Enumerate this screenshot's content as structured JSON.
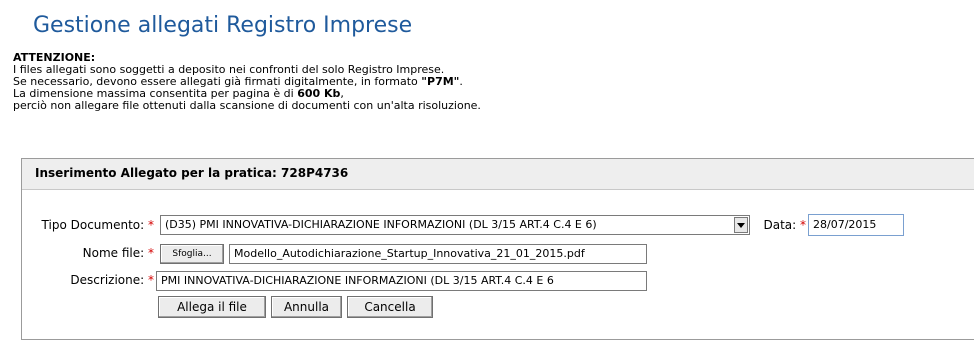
{
  "page": {
    "title": "Gestione allegati Registro Imprese"
  },
  "notice": {
    "heading": "ATTENZIONE:",
    "line1": "I files allegati sono soggetti a deposito nei confronti del solo Registro Imprese.",
    "line2_prefix": "Se necessario, devono essere allegati già firmati digitalmente, in formato ",
    "line2_bold": "\"P7M\"",
    "line2_suffix": ".",
    "line3_prefix": "La dimensione massima consentita per pagina è di ",
    "line3_bold": "600 Kb",
    "line3_suffix": ",",
    "line4": "perciò non allegare file ottenuti dalla scansione di documenti con un'alta risoluzione."
  },
  "form": {
    "header": "Inserimento Allegato per la pratica: 728P4736",
    "required_mark": "*",
    "tipo_documento": {
      "label": "Tipo Documento:",
      "value": "(D35) PMI INNOVATIVA-DICHIARAZIONE INFORMAZIONI (DL 3/15 ART.4 C.4 E 6)"
    },
    "data": {
      "label": "Data:",
      "value": "28/07/2015"
    },
    "nome_file": {
      "label": "Nome file:",
      "browse_label": "Sfoglia...",
      "value": "Modello_Autodichiarazione_Startup_Innovativa_21_01_2015.pdf"
    },
    "descrizione": {
      "label": "Descrizione:",
      "value": "PMI INNOVATIVA-DICHIARAZIONE INFORMAZIONI (DL 3/15 ART.4 C.4 E 6"
    },
    "buttons": {
      "allega": "Allega il file",
      "annulla": "Annulla",
      "cancella": "Cancella"
    }
  },
  "colors": {
    "title": "#1f5a9c",
    "required": "#d40000"
  }
}
